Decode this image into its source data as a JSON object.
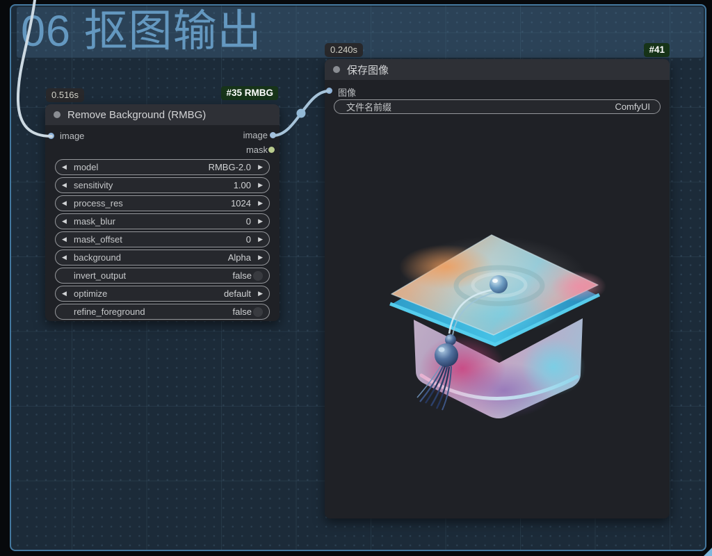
{
  "group": {
    "title": "06 抠图输出"
  },
  "icons": {
    "combo_prev": "◀",
    "combo_next": "▶",
    "collapse_dot": "circle",
    "reroute_dot": "circle"
  },
  "colors": {
    "canvas_bg": "#1c2b39",
    "canvas_border": "#44789f",
    "group_fill": "rgba(92,144,184,0.24)",
    "node_bg": "#1f2126",
    "node_header": "#2e3036",
    "badge_bg": "#173419",
    "image_port": "#8fb3d9",
    "mask_port": "#bacb8e",
    "wire": "#a6c3d9"
  },
  "nodes": {
    "rmbg": {
      "timing": "0.516s",
      "badge": "#35 RMBG",
      "title": "Remove Background (RMBG)",
      "inputs": [
        {
          "name": "image"
        }
      ],
      "outputs": [
        {
          "name": "image"
        },
        {
          "name": "mask"
        }
      ],
      "widgets": [
        {
          "label": "model",
          "value": "RMBG-2.0",
          "type": "combo"
        },
        {
          "label": "sensitivity",
          "value": "1.00",
          "type": "number"
        },
        {
          "label": "process_res",
          "value": "1024",
          "type": "number"
        },
        {
          "label": "mask_blur",
          "value": "0",
          "type": "number"
        },
        {
          "label": "mask_offset",
          "value": "0",
          "type": "number"
        },
        {
          "label": "background",
          "value": "Alpha",
          "type": "combo"
        },
        {
          "label": "invert_output",
          "value": "false",
          "type": "toggle"
        },
        {
          "label": "optimize",
          "value": "default",
          "type": "combo"
        },
        {
          "label": "refine_foreground",
          "value": "false",
          "type": "toggle"
        }
      ]
    },
    "save": {
      "timing": "0.240s",
      "badge": "#41",
      "title": "保存图像",
      "inputs": [
        {
          "name": "图像"
        }
      ],
      "widgets": [
        {
          "label": "文件名前缀",
          "value": "ComfyUI"
        }
      ],
      "preview_alt": "iridescent 3D graduation cap on frosted translucent cube"
    }
  }
}
